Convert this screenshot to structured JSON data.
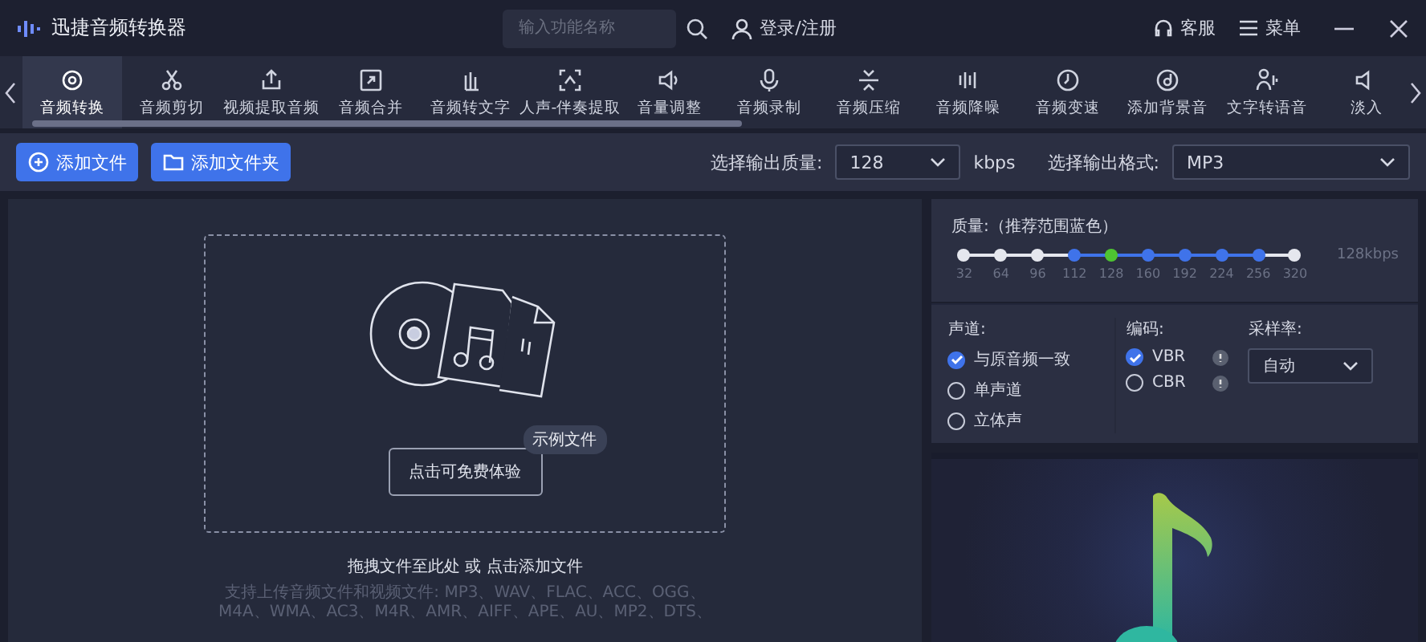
{
  "app": {
    "title": "迅捷音频转换器",
    "search": {
      "placeholder": "输入功能名称"
    },
    "login": "登录/注册",
    "service": "客服",
    "menu": "菜单"
  },
  "tools": [
    {
      "label": "音频转换",
      "selected": true
    },
    {
      "label": "音频剪切",
      "selected": false
    },
    {
      "label": "视频提取音频",
      "selected": false
    },
    {
      "label": "音频合并",
      "selected": false
    },
    {
      "label": "音频转文字",
      "selected": false
    },
    {
      "label": "人声-伴奏提取",
      "selected": false
    },
    {
      "label": "音量调整",
      "selected": false
    },
    {
      "label": "音频录制",
      "selected": false
    },
    {
      "label": "音频压缩",
      "selected": false
    },
    {
      "label": "音频降噪",
      "selected": false
    },
    {
      "label": "音频变速",
      "selected": false
    },
    {
      "label": "添加背景音",
      "selected": false
    },
    {
      "label": "文字转语音",
      "selected": false
    },
    {
      "label": "淡入",
      "selected": false
    }
  ],
  "actions": {
    "add_file": "添加文件",
    "add_folder": "添加文件夹",
    "quality_label": "选择输出质量:",
    "quality": "128",
    "quality_unit": "kbps",
    "format_label": "选择输出格式:",
    "format": "MP3"
  },
  "dropzone": {
    "sample_tag": "示例文件",
    "try_button": "点击可免费体验",
    "hint": "拖拽文件至此处 或 点击添加文件",
    "formats": [
      "支持上传音频文件和视频文件: MP3、WAV、FLAC、ACC、OGG、",
      "M4A、WMA、AC3、M4R、AMR、AIFF、APE、AU、MP2、DTS、"
    ]
  },
  "settings": {
    "quality_title": "质量:（推荐范围蓝色）",
    "reading": "128kbps",
    "ticks": [
      {
        "label": "32",
        "recommended": false,
        "selected": false
      },
      {
        "label": "64",
        "recommended": false,
        "selected": false
      },
      {
        "label": "96",
        "recommended": false,
        "selected": false
      },
      {
        "label": "112",
        "recommended": true,
        "selected": false
      },
      {
        "label": "128",
        "recommended": true,
        "selected": true
      },
      {
        "label": "160",
        "recommended": true,
        "selected": false
      },
      {
        "label": "192",
        "recommended": true,
        "selected": false
      },
      {
        "label": "224",
        "recommended": true,
        "selected": false
      },
      {
        "label": "256",
        "recommended": true,
        "selected": false
      },
      {
        "label": "320",
        "recommended": false,
        "selected": false
      }
    ],
    "channel_title": "声道:",
    "channels": [
      {
        "label": "与原音频一致",
        "selected": true
      },
      {
        "label": "单声道",
        "selected": false
      },
      {
        "label": "立体声",
        "selected": false
      }
    ],
    "encoding_title": "编码:",
    "encodings": [
      {
        "label": "VBR",
        "selected": true
      },
      {
        "label": "CBR",
        "selected": false
      }
    ],
    "rate_title": "采样率:",
    "rate": "自动"
  }
}
